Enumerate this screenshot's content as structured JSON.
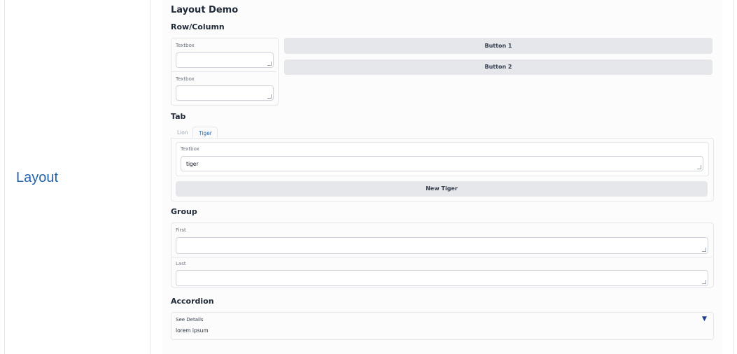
{
  "sidebar_label": "Layout",
  "demo": {
    "title": "Layout Demo",
    "row_column": {
      "heading": "Row/Column",
      "textbox1_label": "Textbox",
      "textbox1_value": "",
      "textbox2_label": "Textbox",
      "textbox2_value": "",
      "button1": "Button 1",
      "button2": "Button 2"
    },
    "tab": {
      "heading": "Tab",
      "tabs": [
        "Lion",
        "Tiger"
      ],
      "selected": "Tiger",
      "textbox_label": "Textbox",
      "textbox_value": "tiger",
      "button": "New Tiger"
    },
    "group": {
      "heading": "Group",
      "first_label": "First",
      "first_value": "",
      "last_label": "Last",
      "last_value": ""
    },
    "accordion": {
      "heading": "Accordion",
      "title": "See Details",
      "content": "lorem ipsum",
      "chevron_icon": "triangle-down-icon"
    }
  },
  "colors": {
    "accent_text": "#2563a8",
    "button_bg": "#e5e7eb",
    "chevron": "#1e3a8a"
  }
}
